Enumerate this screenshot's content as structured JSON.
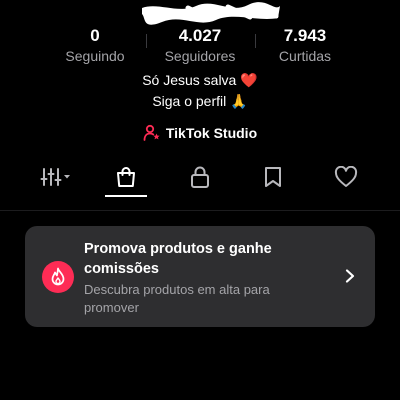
{
  "profile": {
    "stats": {
      "following": {
        "value": "0",
        "label": "Seguindo"
      },
      "followers": {
        "value": "4.027",
        "label": "Seguidores"
      },
      "likes": {
        "value": "7.943",
        "label": "Curtidas"
      }
    },
    "bio": {
      "line1": "Só Jesus salva",
      "line1_emoji": "❤️",
      "line2": "Siga o perfil",
      "line2_emoji": "🙏"
    },
    "studio_link": {
      "label": "TikTok Studio",
      "icon": "person-star-icon"
    }
  },
  "tabs": [
    {
      "icon": "filter-sliders-icon",
      "active": false
    },
    {
      "icon": "shopping-bag-icon",
      "active": true
    },
    {
      "icon": "lock-icon",
      "active": false
    },
    {
      "icon": "bookmark-icon",
      "active": false
    },
    {
      "icon": "heart-icon",
      "active": false
    }
  ],
  "promo_card": {
    "title": "Promova produtos e ganhe comissões",
    "subtitle": "Descubra produtos em alta para promover",
    "icon": "flame-icon",
    "chevron": "chevron-right-icon"
  },
  "colors": {
    "background": "#000000",
    "accent": "#fe2c55",
    "card": "#2e2e30",
    "muted_text": "#a4a4a8"
  }
}
